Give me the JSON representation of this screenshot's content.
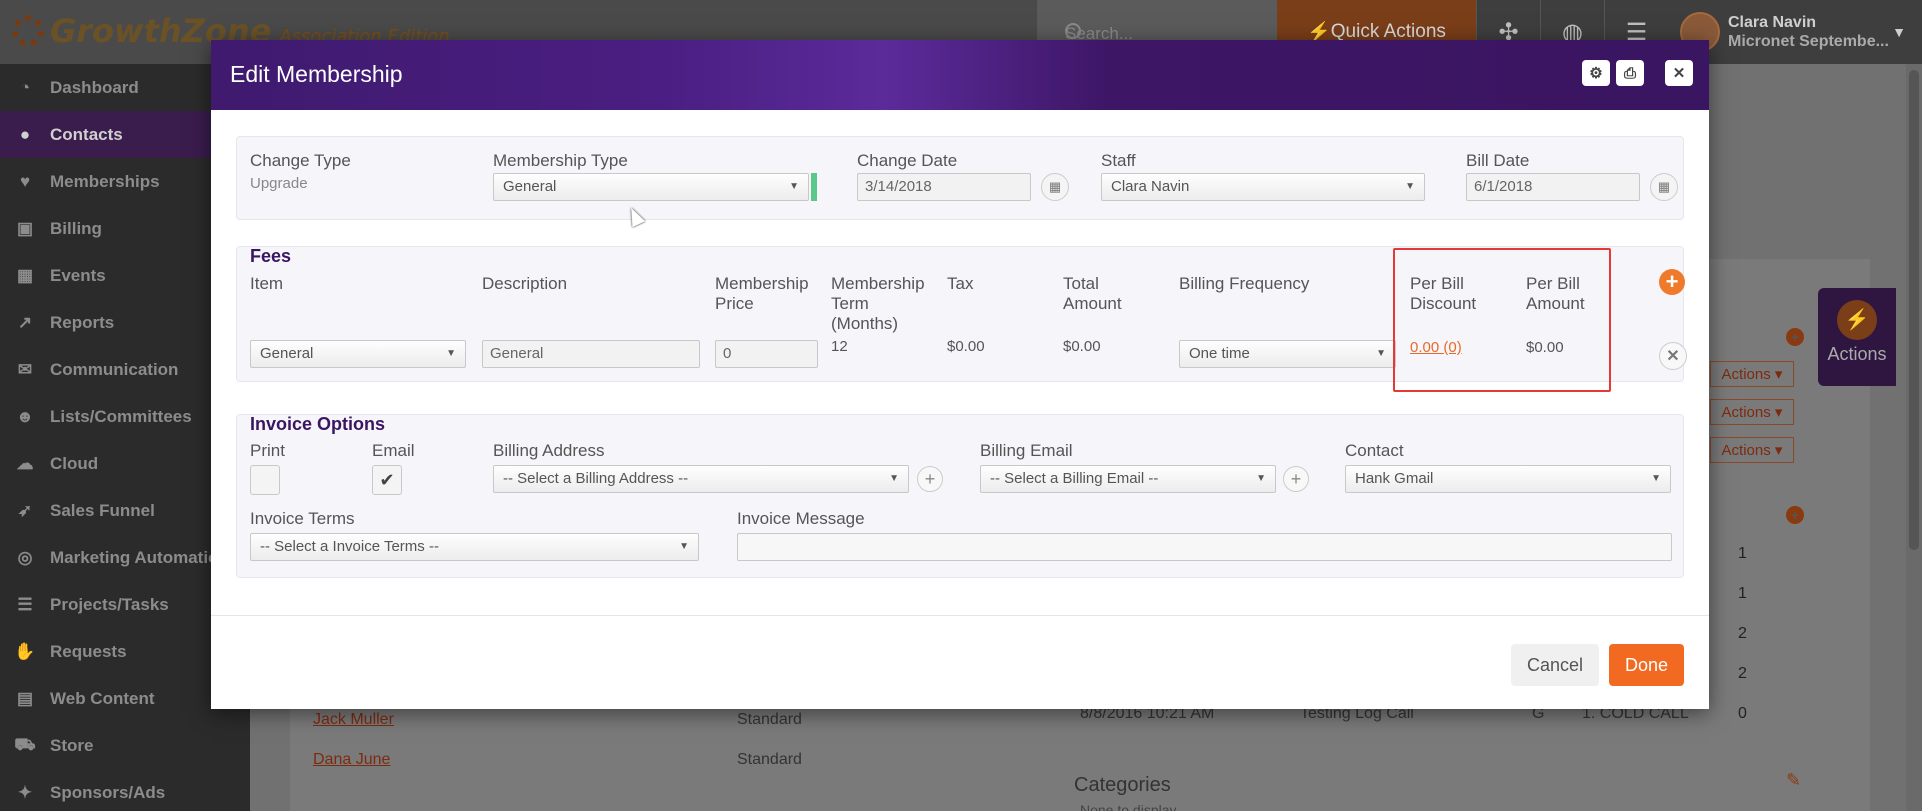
{
  "app": {
    "logo_text": "GrowthZone",
    "logo_edition": "Association Edition",
    "search_placeholder": "Search...",
    "quick_actions_label": "Quick Actions",
    "user_name": "Clara Navin",
    "user_org": "Micronet Septembe..."
  },
  "sidebar": {
    "items": [
      {
        "label": "Dashboard",
        "icon": "dashboard-icon",
        "glyph": "◔"
      },
      {
        "label": "Contacts",
        "icon": "user-icon",
        "glyph": "●"
      },
      {
        "label": "Memberships",
        "icon": "heart-icon",
        "glyph": "♥"
      },
      {
        "label": "Billing",
        "icon": "money-icon",
        "glyph": "▣"
      },
      {
        "label": "Events",
        "icon": "calendar-icon",
        "glyph": "▦"
      },
      {
        "label": "Reports",
        "icon": "chart-icon",
        "glyph": "↗"
      },
      {
        "label": "Communication",
        "icon": "envelope-icon",
        "glyph": "✉"
      },
      {
        "label": "Lists/Committees",
        "icon": "users-icon",
        "glyph": "☻"
      },
      {
        "label": "Cloud",
        "icon": "cloud-icon",
        "glyph": "☁"
      },
      {
        "label": "Sales Funnel",
        "icon": "rocket-icon",
        "glyph": "➶"
      },
      {
        "label": "Marketing Automation",
        "icon": "target-icon",
        "glyph": "◎"
      },
      {
        "label": "Projects/Tasks",
        "icon": "tasks-icon",
        "glyph": "☰"
      },
      {
        "label": "Requests",
        "icon": "hand-icon",
        "glyph": "✋"
      },
      {
        "label": "Web Content",
        "icon": "web-icon",
        "glyph": "▤"
      },
      {
        "label": "Store",
        "icon": "cart-icon",
        "glyph": "⛟"
      },
      {
        "label": "Sponsors/Ads",
        "icon": "sponsor-icon",
        "glyph": "✦"
      }
    ],
    "active_index": 1
  },
  "background": {
    "links": [
      "Jack Muller",
      "Dana June"
    ],
    "types": [
      "Standard",
      "Standard"
    ],
    "action_label": "Actions",
    "actions_tab_label": "Actions",
    "log_date": "8/8/2016 10:21 AM",
    "log_text": "Testing Log Call",
    "log_g": "G",
    "log_stage": "1. COLD CALL",
    "counts": [
      "1",
      "1",
      "2",
      "2",
      "0"
    ],
    "categories_title": "Categories",
    "categories_empty": "None to display"
  },
  "modal": {
    "title": "Edit Membership",
    "top_row": {
      "change_type_label": "Change Type",
      "change_type_value": "Upgrade",
      "membership_type_label": "Membership Type",
      "membership_type_value": "General",
      "change_date_label": "Change Date",
      "change_date_value": "3/14/2018",
      "staff_label": "Staff",
      "staff_value": "Clara Navin",
      "bill_date_label": "Bill Date",
      "bill_date_value": "6/1/2018"
    },
    "fees": {
      "title": "Fees",
      "headers": {
        "item": "Item",
        "description": "Description",
        "price_l1": "Membership",
        "price_l2": "Price",
        "term_l1": "Membership",
        "term_l2": "Term",
        "term_l3": "(Months)",
        "tax": "Tax",
        "total_l1": "Total",
        "total_l2": "Amount",
        "freq": "Billing Frequency",
        "discount_l1": "Per Bill",
        "discount_l2": "Discount",
        "amount_l1": "Per Bill",
        "amount_l2": "Amount"
      },
      "row": {
        "item": "General",
        "description": "General",
        "price": "0",
        "term": "12",
        "tax": "$0.00",
        "total": "$0.00",
        "frequency": "One time",
        "discount": "0.00 (0)",
        "amount": "$0.00"
      }
    },
    "invoice": {
      "title": "Invoice Options",
      "print_label": "Print",
      "email_label": "Email",
      "billing_address_label": "Billing Address",
      "billing_address_value": "-- Select a Billing Address --",
      "billing_email_label": "Billing Email",
      "billing_email_value": "-- Select a Billing Email --",
      "contact_label": "Contact",
      "contact_value": "Hank Gmail",
      "terms_label": "Invoice Terms",
      "terms_value": "-- Select a Invoice Terms --",
      "message_label": "Invoice Message",
      "message_value": ""
    },
    "footer": {
      "cancel_label": "Cancel",
      "done_label": "Done"
    }
  },
  "colors": {
    "header_purple": "#3f1a6e",
    "accent_orange": "#f26a21",
    "highlight_red": "#e53935",
    "section_title": "#3a1561"
  }
}
